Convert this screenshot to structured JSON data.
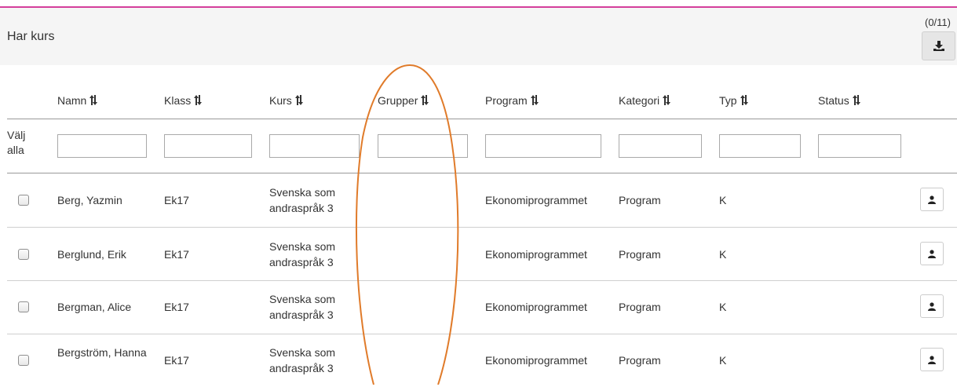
{
  "panel": {
    "title": "Har kurs",
    "count": "(0/11)"
  },
  "columns": {
    "namn": "Namn",
    "klass": "Klass",
    "kurs": "Kurs",
    "grupper": "Grupper",
    "program": "Program",
    "kategori": "Kategori",
    "typ": "Typ",
    "status": "Status"
  },
  "select_all": "Välj alla",
  "filters": {
    "namn": "",
    "klass": "",
    "kurs": "",
    "grupper": "",
    "program": "",
    "kategori": "",
    "typ": "",
    "status": ""
  },
  "rows": [
    {
      "namn": "Berg, Yazmin",
      "klass": "Ek17",
      "kurs": "Svenska som andraspråk 3",
      "grupper": "",
      "program": "Ekonomiprogrammet",
      "kategori": "Program",
      "typ": "K",
      "status": ""
    },
    {
      "namn": "Berglund, Erik",
      "klass": "Ek17",
      "kurs": "Svenska som andraspråk 3",
      "grupper": "",
      "program": "Ekonomiprogrammet",
      "kategori": "Program",
      "typ": "K",
      "status": ""
    },
    {
      "namn": "Bergman, Alice",
      "klass": "Ek17",
      "kurs": "Svenska som andraspråk 3",
      "grupper": "",
      "program": "Ekonomiprogrammet",
      "kategori": "Program",
      "typ": "K",
      "status": ""
    },
    {
      "namn": "Bergström, Hanna",
      "klass": "Ek17",
      "kurs": "Svenska som andraspråk 3",
      "grupper": "",
      "program": "Ekonomiprogrammet",
      "kategori": "Program",
      "typ": "K",
      "status": ""
    }
  ],
  "icons": {
    "download": "download-icon",
    "sort": "sort-icon",
    "person": "person-icon"
  },
  "colors": {
    "accent_line": "#d43f9b",
    "highlight_oval": "#e07b2a",
    "header_bg": "#f5f5f5"
  }
}
